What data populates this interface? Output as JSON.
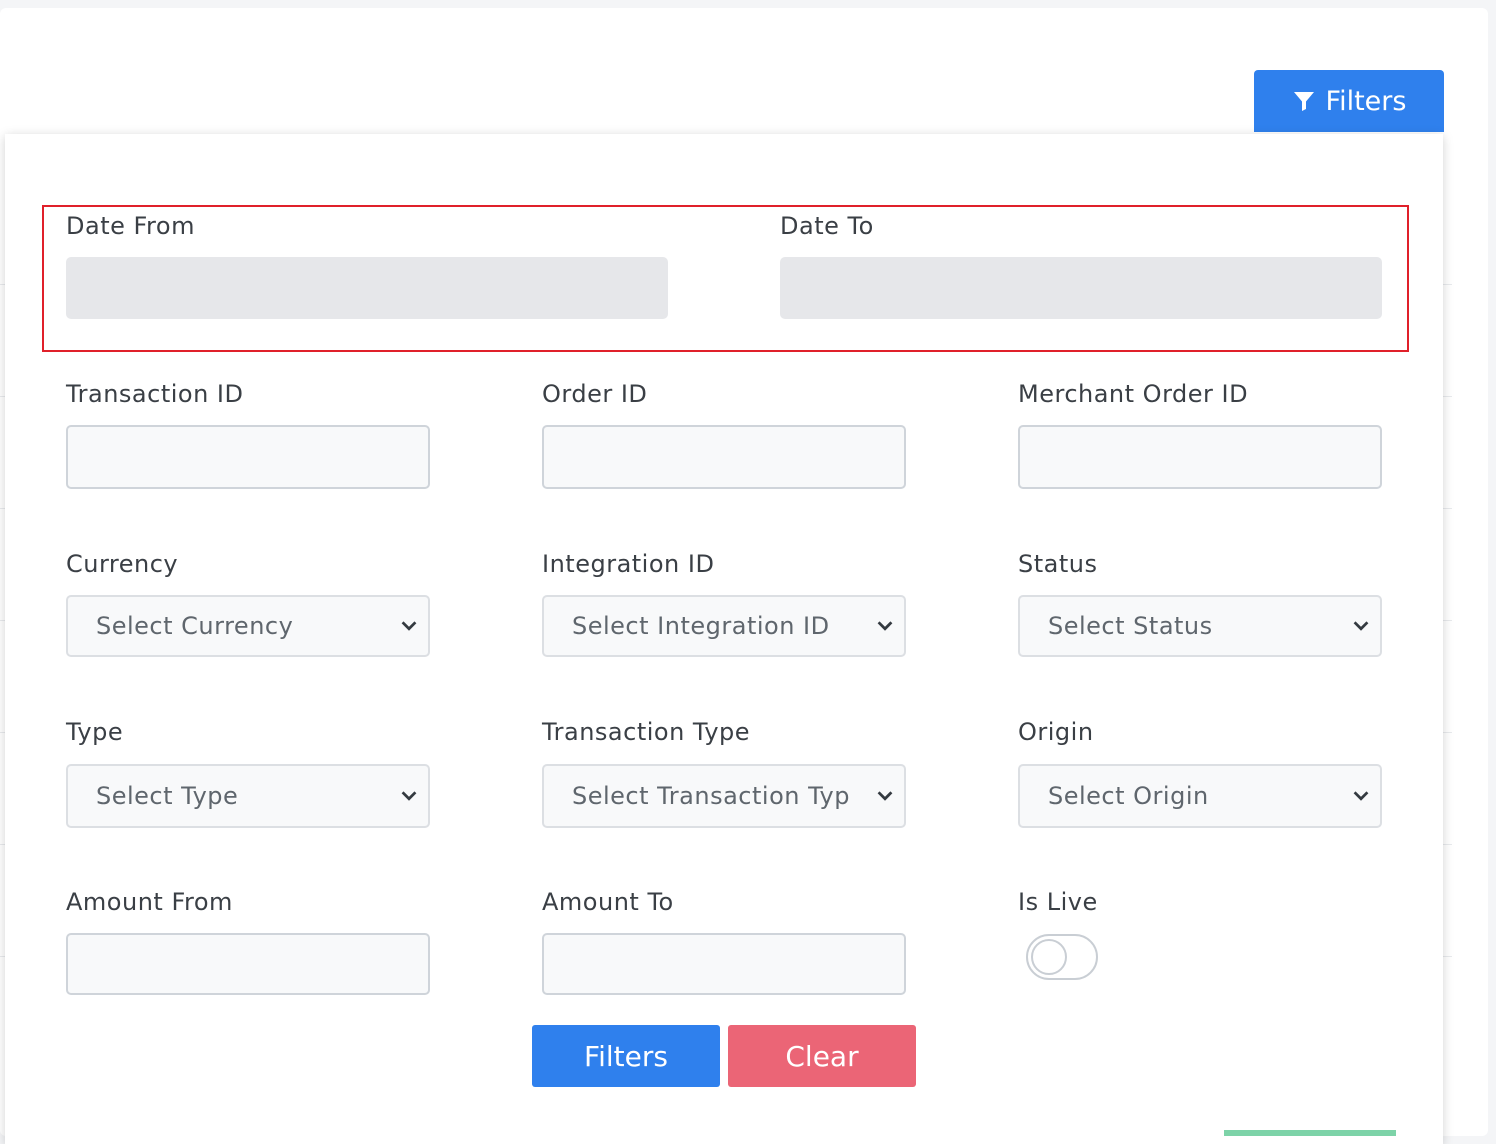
{
  "toolbar": {
    "filters_button_label": "Filters"
  },
  "filter_panel": {
    "date_from": {
      "label": "Date From",
      "value": ""
    },
    "date_to": {
      "label": "Date To",
      "value": ""
    },
    "transaction_id": {
      "label": "Transaction ID",
      "value": ""
    },
    "order_id": {
      "label": "Order ID",
      "value": ""
    },
    "merchant_order_id": {
      "label": "Merchant Order ID",
      "value": ""
    },
    "currency": {
      "label": "Currency",
      "selected": "Select Currency"
    },
    "integration_id": {
      "label": "Integration ID",
      "selected": "Select Integration ID"
    },
    "status": {
      "label": "Status",
      "selected": "Select Status"
    },
    "type": {
      "label": "Type",
      "selected": "Select Type"
    },
    "transaction_type": {
      "label": "Transaction Type",
      "selected": "Select Transaction Typ"
    },
    "origin": {
      "label": "Origin",
      "selected": "Select Origin"
    },
    "amount_from": {
      "label": "Amount From",
      "value": ""
    },
    "amount_to": {
      "label": "Amount To",
      "value": ""
    },
    "is_live": {
      "label": "Is Live",
      "checked": false
    },
    "submit_label": "Filters",
    "clear_label": "Clear"
  },
  "colors": {
    "primary": "#2f80ed",
    "danger": "#eb6576",
    "highlight_border": "#e0202a"
  }
}
